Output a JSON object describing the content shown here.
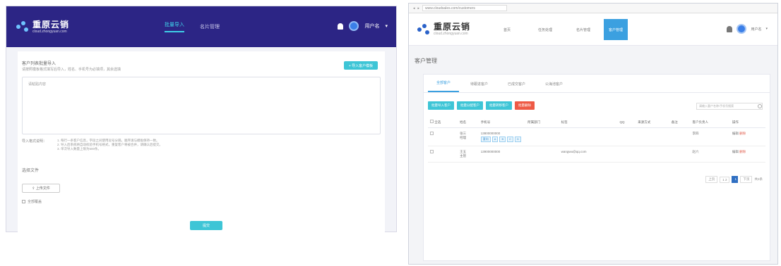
{
  "left": {
    "brand": {
      "title": "重原云销",
      "subtitle": "cloud.zhongyuan.com"
    },
    "nav": [
      {
        "label": "批量导入"
      },
      {
        "label": "名片管理"
      }
    ],
    "user": {
      "name": "用户名"
    },
    "section_title": "客户列表批量导入",
    "section_subtitle": "请按照模板格式填写后导入，姓名、手机号为必填项，其余选填",
    "add_button": "+ 导入客户模板",
    "textarea_placeholder": "请粘贴内容",
    "tips_label": "导入格式说明：",
    "tips": [
      "1. 每行一条客户信息，字段之间使用逗号分隔，顺序请与模板保持一致。",
      "2. 导入后系统将自动校验手机号格式，重复客户将被合并，请确认后提交。",
      "3. 单次导入数量上限为500条。"
    ],
    "upload_title": "选择文件",
    "upload_button": "上传文件",
    "checkbox_label": "全部覆盖",
    "submit": "提交"
  },
  "right": {
    "address": "www.cloudsales.com/customers",
    "brand": {
      "title": "重原云销",
      "subtitle": "cloud.zhongyuan.com"
    },
    "nav": [
      "首页",
      "任务处理",
      "名片管理",
      "客户管理"
    ],
    "user": {
      "name": "用户名"
    },
    "page_title": "客户管理",
    "tabs": [
      "全部客户",
      "待跟进客户",
      "已成交客户",
      "公海池客户"
    ],
    "actions": [
      "批量导入客户",
      "批量分配客户",
      "批量转移客户",
      "批量删除"
    ],
    "search_placeholder": "请输入客户名称/手机号搜索",
    "table_headers": [
      "全选",
      "姓名",
      "手机号",
      "所属部门",
      "标签",
      "QQ",
      "来源方式",
      "备注",
      "客户负责人",
      "操作"
    ],
    "rows": [
      {
        "name": "张三",
        "sub": "经理",
        "phone": "13800000000",
        "dept": "",
        "email": "",
        "qq": "",
        "source": "",
        "note": "",
        "owner": "李四",
        "edit": "编辑",
        "del": "删除",
        "tags": [
          "意向",
          "A",
          "B",
          "C",
          "D"
        ]
      },
      {
        "name": "王五",
        "sub": "主管",
        "phone": "13900000000",
        "dept": "",
        "email": "wangwu@qq.com",
        "qq": "",
        "source": "",
        "note": "",
        "owner": "赵六",
        "edit": "编辑",
        "del": "删除",
        "tags": []
      }
    ],
    "pager": {
      "prev": "上页",
      "first": "1 2",
      "current": "1",
      "next": "下页",
      "total": "共2条"
    }
  }
}
